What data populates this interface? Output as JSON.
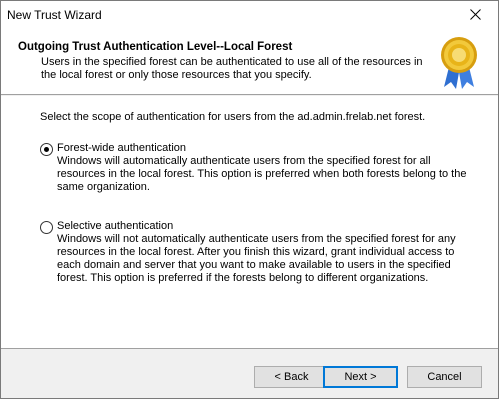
{
  "window": {
    "title": "New Trust Wizard"
  },
  "header": {
    "title": "Outgoing Trust Authentication Level--Local Forest",
    "subtitle": "Users in the specified forest can be authenticated to use all of the resources in the local forest or only those resources that you specify."
  },
  "content": {
    "prompt": "Select the scope of authentication for users from the ad.admin.frelab.net forest.",
    "options": [
      {
        "label": "Forest-wide authentication",
        "selected": true,
        "description": "Windows will automatically authenticate users from the specified forest for all resources in the local forest. This option is preferred when both forests belong to the same organization."
      },
      {
        "label": "Selective authentication",
        "selected": false,
        "description": "Windows will not automatically authenticate users from the specified forest for any resources in the local forest. After you finish this wizard, grant individual access to each domain and server that you want to make available to users in the specified forest. This option is preferred if the forests belong to different organizations."
      }
    ]
  },
  "buttons": {
    "back": "< Back",
    "next": "Next >",
    "cancel": "Cancel"
  },
  "icons": {
    "close": "close-icon",
    "medal": "award-ribbon-icon"
  },
  "colors": {
    "accent": "#0078d7",
    "medal_gold": "#e8b419",
    "ribbon_blue": "#2f6fd1"
  }
}
